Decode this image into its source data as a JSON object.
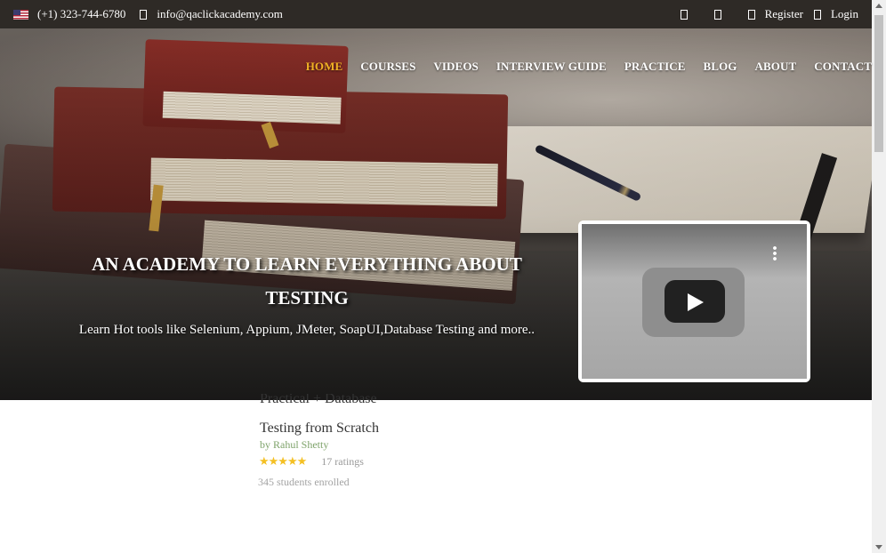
{
  "topbar": {
    "phone": "(+1) 323-744-6780",
    "email": "info@qaclickacademy.com",
    "register_label": "Register",
    "login_label": "Login"
  },
  "nav": {
    "items": [
      {
        "label": "HOME",
        "active": true
      },
      {
        "label": "COURSES"
      },
      {
        "label": "VIDEOS"
      },
      {
        "label": "INTERVIEW GUIDE"
      },
      {
        "label": "PRACTICE"
      },
      {
        "label": "BLOG"
      },
      {
        "label": "ABOUT"
      },
      {
        "label": "CONTACT"
      }
    ]
  },
  "hero": {
    "title": "AN ACADEMY TO LEARN EVERYTHING ABOUT TESTING",
    "subtitle": "Learn Hot tools like Selenium, Appium, JMeter, SoapUI,Database Testing and more.."
  },
  "course": {
    "title_line1": "Practical + Database",
    "title_line2": "Testing from Scratch",
    "author": "by Rahul Shetty",
    "stars": "★★★★★",
    "ratings": "17 ratings",
    "students": "345 students enrolled"
  },
  "colors": {
    "topbar_bg": "#2e2a26",
    "nav_active": "#f1b224",
    "author": "#7ea36a",
    "stars": "#f4c024"
  }
}
